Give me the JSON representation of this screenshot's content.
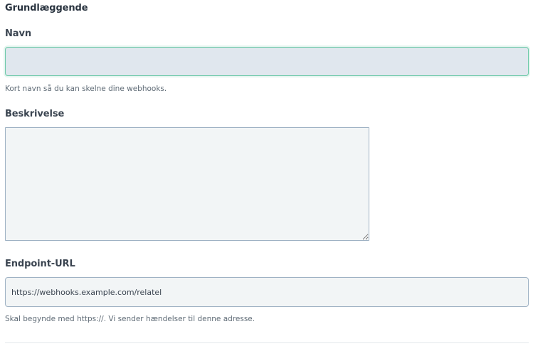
{
  "section": {
    "title": "Grundlæggende"
  },
  "fields": {
    "name": {
      "label": "Navn",
      "value": "",
      "help": "Kort navn så du kan skelne dine webhooks."
    },
    "description": {
      "label": "Beskrivelse",
      "value": ""
    },
    "endpoint_url": {
      "label": "Endpoint-URL",
      "value": "https://webhooks.example.com/relatel",
      "help": "Skal begynde med https://. Vi sender hændelser til denne adresse."
    }
  },
  "colors": {
    "focus_border": "#6cc9a8",
    "input_border": "#9fb2c4",
    "focused_input_bg": "#e0e7ee",
    "input_bg": "#f2f5f6",
    "text": "#2a3440",
    "help_text": "#5f6b76"
  }
}
